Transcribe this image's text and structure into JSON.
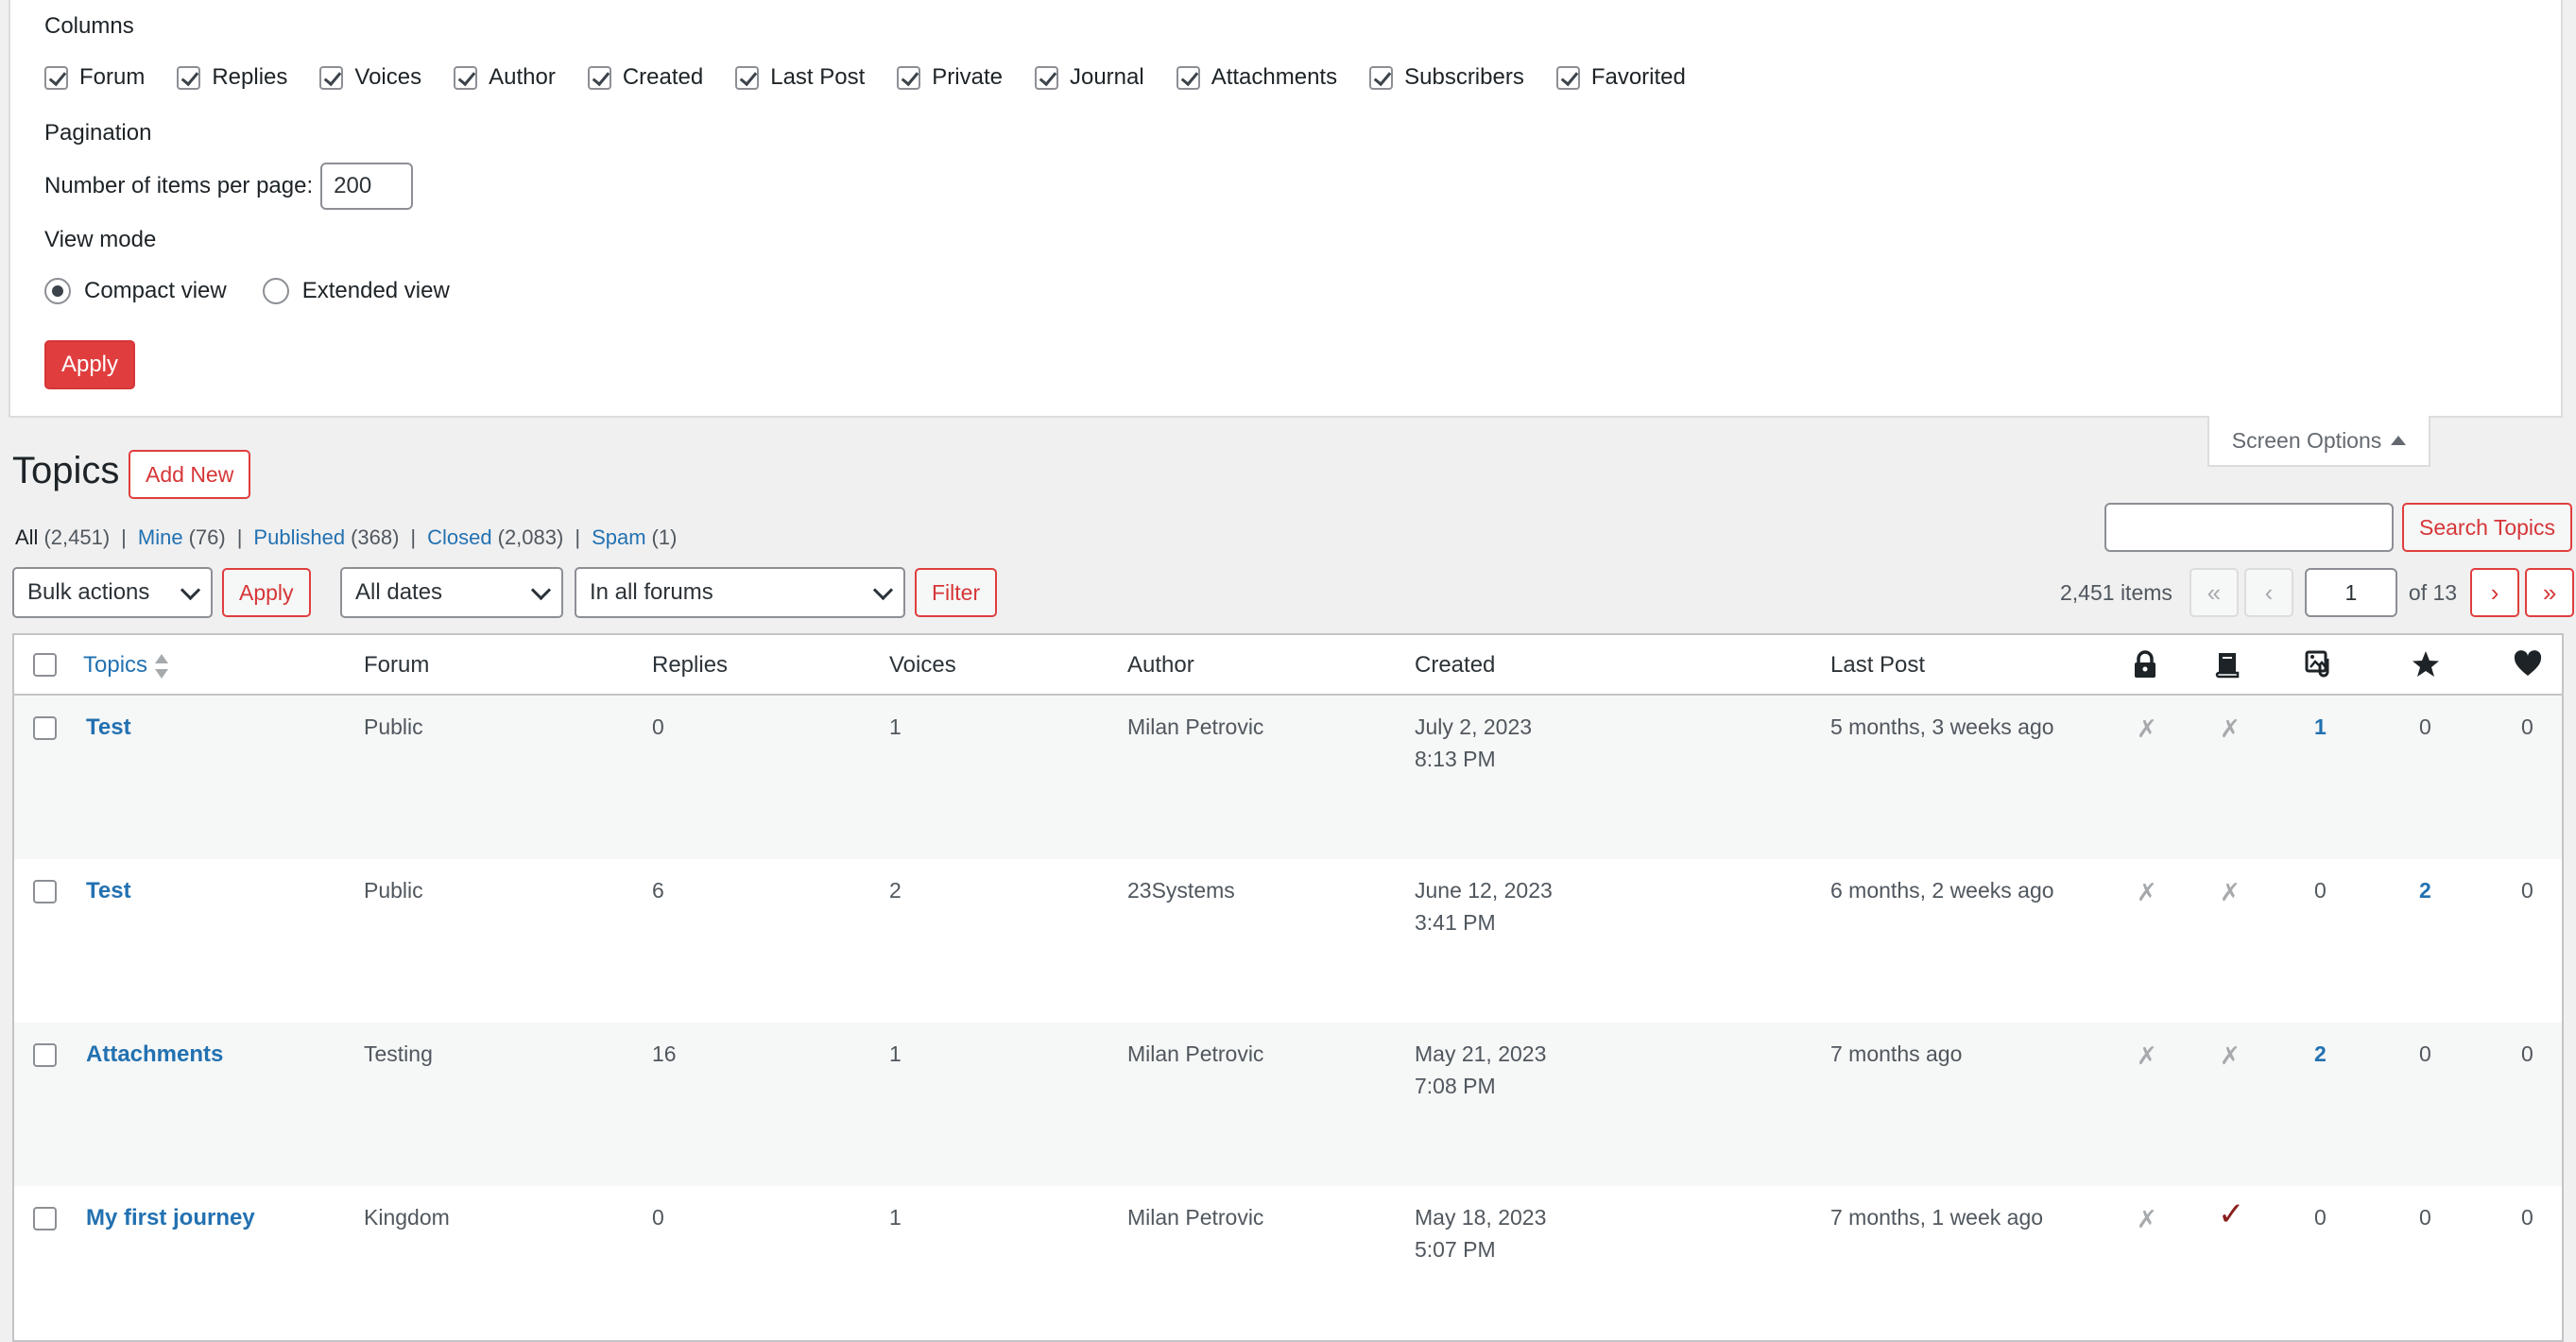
{
  "screen_options": {
    "columns_legend": "Columns",
    "columns": [
      {
        "label": "Forum",
        "checked": true
      },
      {
        "label": "Replies",
        "checked": true
      },
      {
        "label": "Voices",
        "checked": true
      },
      {
        "label": "Author",
        "checked": true
      },
      {
        "label": "Created",
        "checked": true
      },
      {
        "label": "Last Post",
        "checked": true
      },
      {
        "label": "Private",
        "checked": true
      },
      {
        "label": "Journal",
        "checked": true
      },
      {
        "label": "Attachments",
        "checked": true
      },
      {
        "label": "Subscribers",
        "checked": true
      },
      {
        "label": "Favorited",
        "checked": true
      }
    ],
    "pagination_legend": "Pagination",
    "per_page_label": "Number of items per page:",
    "per_page_value": "200",
    "view_mode_legend": "View mode",
    "view_compact": "Compact view",
    "view_extended": "Extended view",
    "apply_label": "Apply",
    "tab_label": "Screen Options"
  },
  "header": {
    "title": "Topics",
    "add_new": "Add New"
  },
  "views": {
    "all": {
      "label": "All",
      "count": "(2,451)"
    },
    "mine": {
      "label": "Mine",
      "count": "(76)"
    },
    "published": {
      "label": "Published",
      "count": "(368)"
    },
    "closed": {
      "label": "Closed",
      "count": "(2,083)"
    },
    "spam": {
      "label": "Spam",
      "count": "(1)"
    }
  },
  "search": {
    "button": "Search Topics",
    "value": ""
  },
  "filters": {
    "bulk_actions": "Bulk actions",
    "apply": "Apply",
    "dates": "All dates",
    "forums": "In all forums",
    "filter": "Filter"
  },
  "pagination": {
    "items": "2,451 items",
    "first": "«",
    "prev": "‹",
    "current_page": "1",
    "of": "of 13",
    "next": "›",
    "last": "»"
  },
  "table": {
    "headers": {
      "topics": "Topics",
      "forum": "Forum",
      "replies": "Replies",
      "voices": "Voices",
      "author": "Author",
      "created": "Created",
      "last_post": "Last Post"
    },
    "header_icons": [
      "lock-icon",
      "book-icon",
      "attachment-icon",
      "star-icon",
      "heart-icon"
    ],
    "rows": [
      {
        "title": "Test",
        "forum": "Public",
        "replies": "0",
        "voices": "1",
        "author": "Milan Petrovic",
        "created_date": "July 2, 2023",
        "created_time": "8:13 PM",
        "last_post": "5 months, 3 weeks ago",
        "private": "✗",
        "journal": "✗",
        "attachments": "1",
        "subscribers": "0",
        "favorited": "0"
      },
      {
        "title": "Test",
        "forum": "Public",
        "replies": "6",
        "voices": "2",
        "author": "23Systems",
        "created_date": "June 12, 2023",
        "created_time": "3:41 PM",
        "last_post": "6 months, 2 weeks ago",
        "private": "✗",
        "journal": "✗",
        "attachments": "0",
        "subscribers": "2",
        "favorited": "0"
      },
      {
        "title": "Attachments",
        "forum": "Testing",
        "replies": "16",
        "voices": "1",
        "author": "Milan Petrovic",
        "created_date": "May 21, 2023",
        "created_time": "7:08 PM",
        "last_post": "7 months ago",
        "private": "✗",
        "journal": "✗",
        "attachments": "2",
        "subscribers": "0",
        "favorited": "0"
      },
      {
        "title": "My first journey",
        "forum": "Kingdom",
        "replies": "0",
        "voices": "1",
        "author": "Milan Petrovic",
        "created_date": "May 18, 2023",
        "created_time": "5:07 PM",
        "last_post": "7 months, 1 week ago",
        "private": "✗",
        "journal": "✓",
        "attachments": "0",
        "subscribers": "0",
        "favorited": "0"
      }
    ]
  },
  "colors": {
    "accent": "#e03e3e",
    "link": "#2271b1",
    "journal_check": "#8a1f1f"
  }
}
